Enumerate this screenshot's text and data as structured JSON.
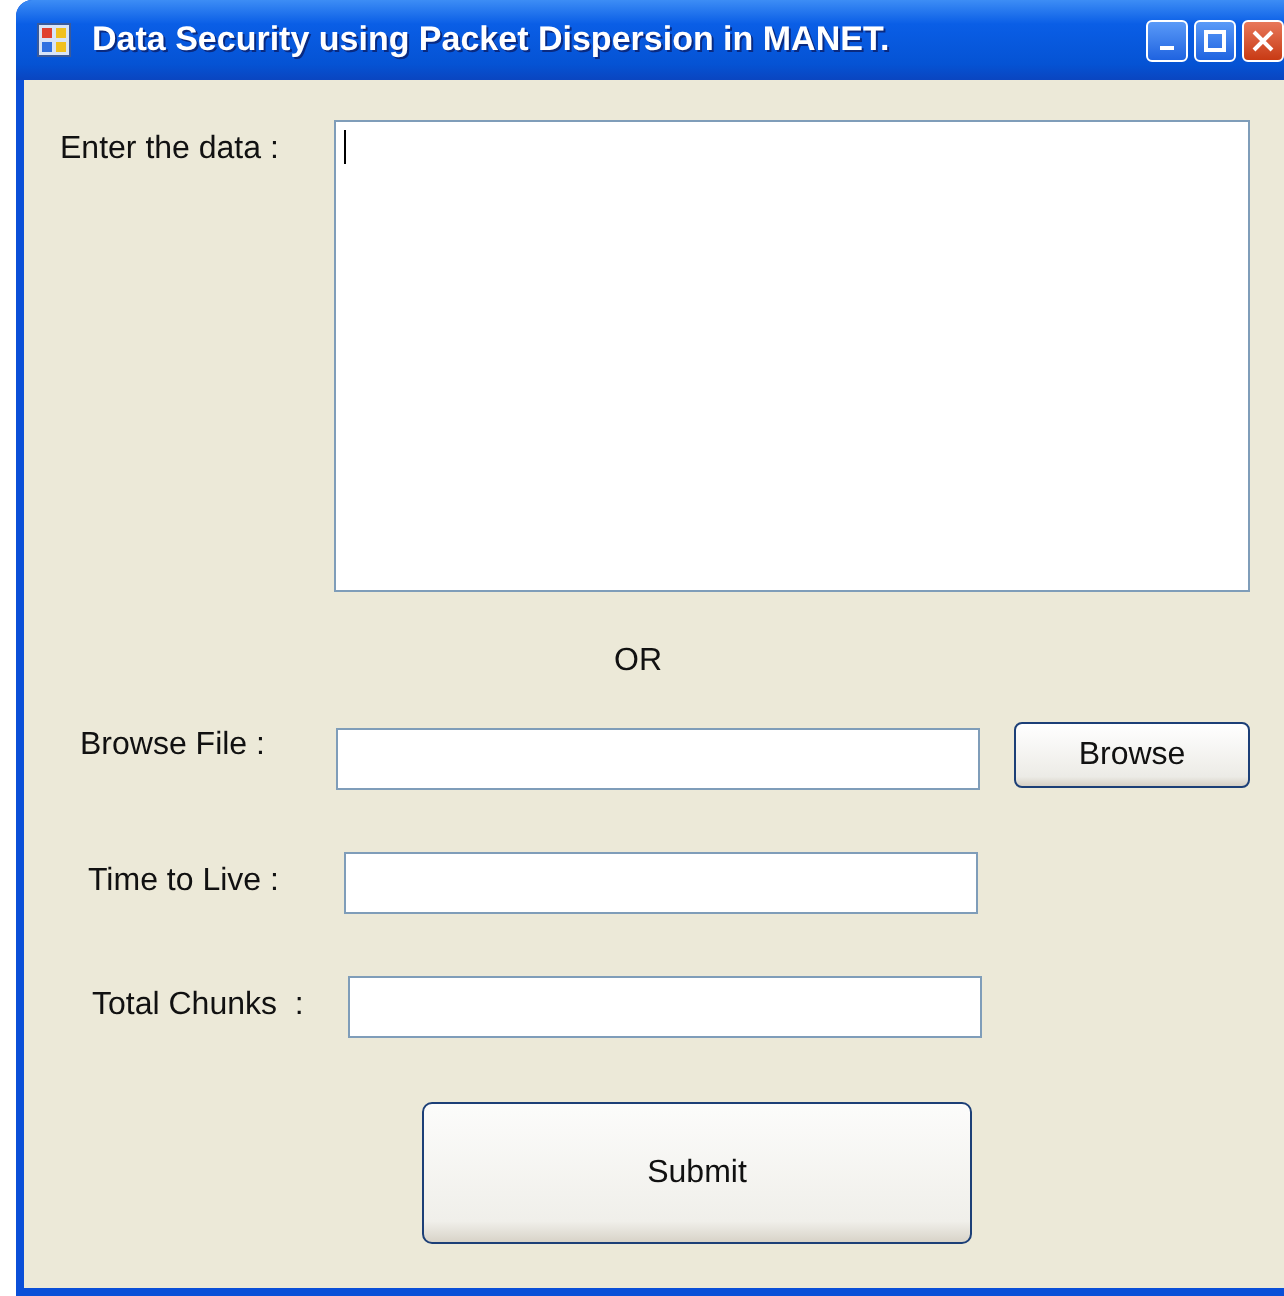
{
  "window": {
    "title": "Data Security using Packet Dispersion in MANET."
  },
  "data_input": {
    "label": "Enter the data :",
    "focused": true
  },
  "separator": "OR",
  "browse": {
    "label": "Browse File :",
    "button": "Browse"
  },
  "ttl": {
    "label": "Time to Live :"
  },
  "chunks": {
    "label": "Total Chunks  :"
  },
  "submit": "Submit"
}
